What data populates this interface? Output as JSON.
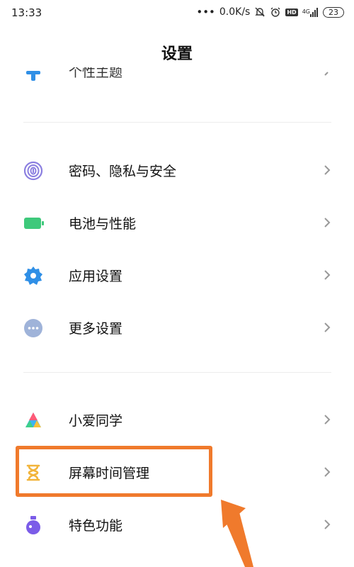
{
  "status_bar": {
    "time": "13:33",
    "dots": "•••",
    "net_speed": "0.0K/s",
    "hd": "HD",
    "signal": "4G",
    "battery": "23"
  },
  "header": {
    "title": "设置"
  },
  "partial_item": {
    "label": "个性主题"
  },
  "items": [
    {
      "label": "密码、隐私与安全",
      "icon": "fingerprint-icon"
    },
    {
      "label": "电池与性能",
      "icon": "battery-icon"
    },
    {
      "label": "应用设置",
      "icon": "gear-icon"
    },
    {
      "label": "更多设置",
      "icon": "more-dots-icon"
    },
    {
      "label": "小爱同学",
      "icon": "xiaoai-icon"
    },
    {
      "label": "屏幕时间管理",
      "icon": "hourglass-icon"
    },
    {
      "label": "特色功能",
      "icon": "flask-icon"
    }
  ],
  "colors": {
    "accent_orange": "#f07a2c",
    "fingerprint": "#8b7fe0",
    "battery": "#3ec97b",
    "gear": "#2f8fe6",
    "more": "#9fb3d9",
    "hourglass": "#f2b43a",
    "flask": "#7b5ce8"
  }
}
